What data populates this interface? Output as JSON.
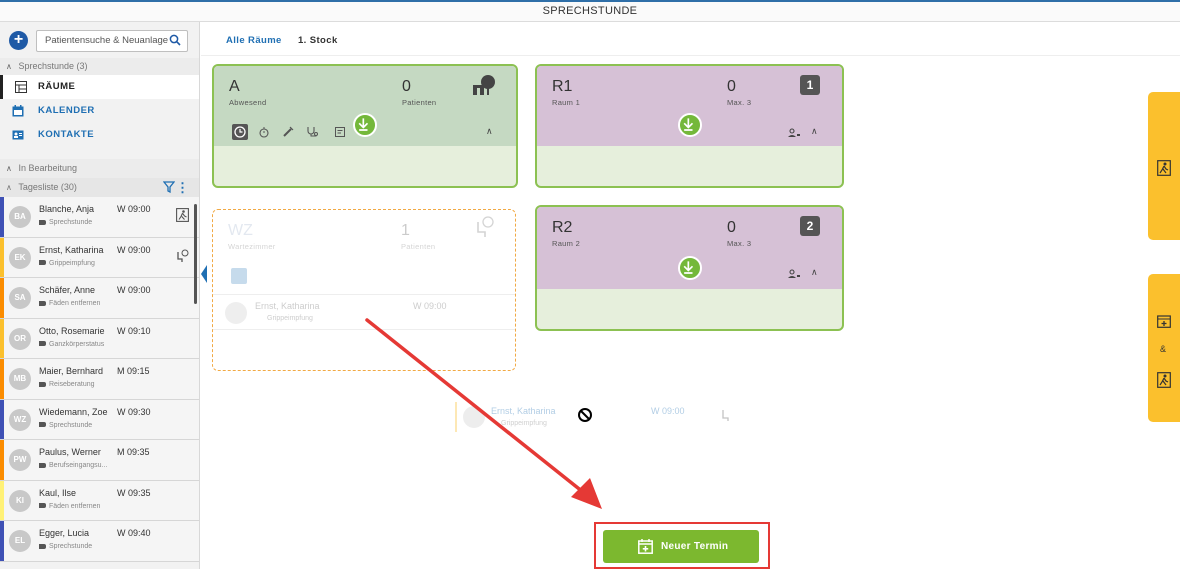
{
  "window": {
    "title": "SPRECHSTUNDE"
  },
  "sidebar": {
    "search_placeholder": "Patientensuche & Neuanlage",
    "sprechstunde_section": "Sprechstunde (3)",
    "nav": [
      {
        "label": "RÄUME",
        "icon": "grid-icon",
        "active": true
      },
      {
        "label": "KALENDER",
        "icon": "calendar-icon",
        "active": false
      },
      {
        "label": "KONTAKTE",
        "icon": "contact-card-icon",
        "active": false
      }
    ],
    "in_bearbeitung": "In Bearbeitung",
    "tagesliste": "Tagesliste (30)",
    "patients": [
      {
        "initials": "BA",
        "name": "Blanche, Anja",
        "time": "W 09:00",
        "reason": "Sprechstunde",
        "color": "#3f51b5",
        "icon": "exit-icon"
      },
      {
        "initials": "EK",
        "name": "Ernst, Katharina",
        "time": "W 09:00",
        "reason": "Grippeimpfung",
        "color": "#fbc02d",
        "icon": "waiting-seat-icon"
      },
      {
        "initials": "SA",
        "name": "Schäfer, Anne",
        "time": "W 09:00",
        "reason": "Fäden entfernen",
        "color": "#fb8c00",
        "icon": ""
      },
      {
        "initials": "OR",
        "name": "Otto, Rosemarie",
        "time": "W 09:10",
        "reason": "Ganzkörperstatus",
        "color": "#fbc02d",
        "icon": ""
      },
      {
        "initials": "MB",
        "name": "Maier, Bernhard",
        "time": "M 09:15",
        "reason": "Reiseberatung",
        "color": "#fb8c00",
        "icon": ""
      },
      {
        "initials": "WZ",
        "name": "Wiedemann, Zoe",
        "time": "W 09:30",
        "reason": "Sprechstunde",
        "color": "#3f51b5",
        "icon": ""
      },
      {
        "initials": "PW",
        "name": "Paulus, Werner",
        "time": "M 09:35",
        "reason": "Berufseingangsu...",
        "color": "#fb8c00",
        "icon": ""
      },
      {
        "initials": "KI",
        "name": "Kaul, Ilse",
        "time": "W 09:35",
        "reason": "Fäden entfernen",
        "color": "#fff176",
        "icon": ""
      },
      {
        "initials": "EL",
        "name": "Egger, Lucia",
        "time": "W 09:40",
        "reason": "Sprechstunde",
        "color": "#3f51b5",
        "icon": ""
      }
    ]
  },
  "tabs": [
    {
      "label": "Alle Räume",
      "active": true
    },
    {
      "label": "1. Stock",
      "active": false
    }
  ],
  "rooms": {
    "a": {
      "code": "A",
      "sub": "Abwesend",
      "count": "0",
      "count_label": "Patienten",
      "header_color": "#c5d9c2"
    },
    "r1": {
      "code": "R1",
      "sub": "Raum 1",
      "count": "0",
      "count_label": "Max. 3",
      "badge": "1",
      "header_color": "#d6c1d6"
    },
    "wz": {
      "code": "WZ",
      "sub": "Wartezimmer",
      "count": "1",
      "count_label": "Patienten",
      "patient": {
        "name": "Ernst, Katharina",
        "reason": "Grippeimpfung",
        "time": "W  09:00"
      }
    },
    "r2": {
      "code": "R2",
      "sub": "Raum 2",
      "count": "0",
      "count_label": "Max. 3",
      "badge": "2",
      "header_color": "#d6c1d6"
    }
  },
  "dragged_card": {
    "name": "Ernst, Katharina",
    "reason": "Grippeimpfung",
    "time": "W  09:00"
  },
  "new_appointment": {
    "label": "Neuer Termin"
  },
  "right_panels": {
    "ampersand": "&"
  },
  "colors": {
    "accent_blue": "#1f6fb3",
    "room_border": "#8cc152",
    "button_green": "#7cb82f",
    "annotation_red": "#e53935",
    "panel_yellow": "#fbc02d"
  }
}
